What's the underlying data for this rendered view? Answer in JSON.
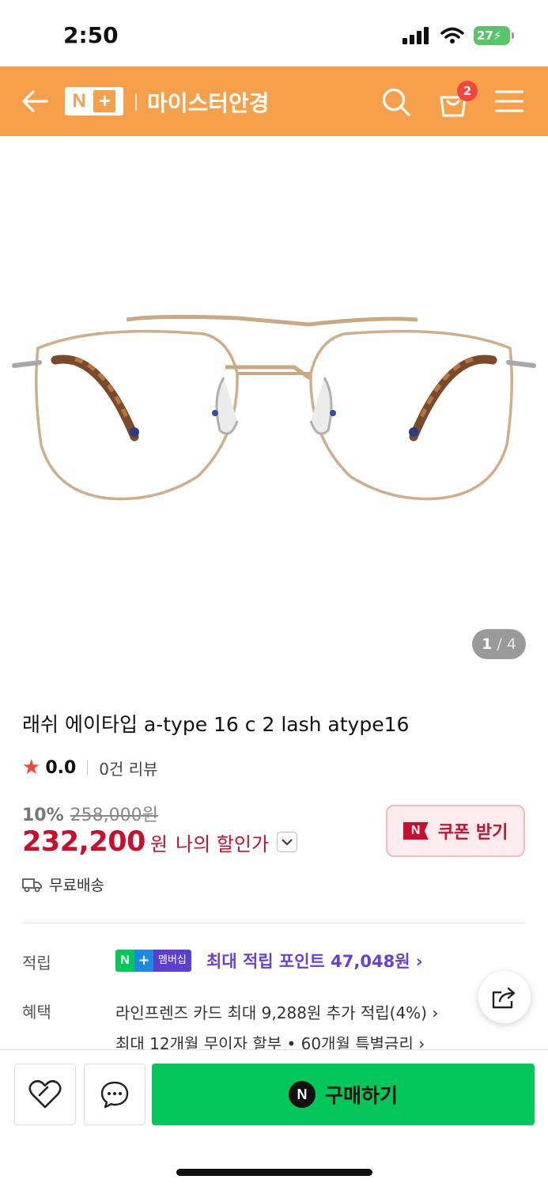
{
  "status": {
    "time": "2:50",
    "battery": "27"
  },
  "header": {
    "logo_n": "N",
    "logo_plus": "+",
    "store_name": "마이스터안경",
    "cart_count": "2"
  },
  "colors": {
    "header": "#f6a04c",
    "price": "#c8102e",
    "buy": "#03c75a",
    "points": "#6a3fd8"
  },
  "gallery": {
    "current": "1",
    "separator": "/",
    "total": "4"
  },
  "product": {
    "title": "래쉬 에이타입 a-type 16 c 2 lash atype16",
    "rating": "0.0",
    "review_count": "0건 리뷰",
    "discount_rate": "10%",
    "original_price": "258,000원",
    "price": "232,200",
    "currency": "원",
    "my_price_label": "나의 할인가",
    "coupon_label": "쿠폰 받기",
    "shipping": "무료배송"
  },
  "points": {
    "label": "적립",
    "membership_badge": "멤버십",
    "text": "최대 적립 포인트 47,048원"
  },
  "benefits": {
    "label": "혜택",
    "items": [
      "라인프렌즈 카드 최대 9,288원 추가 적립(4%)",
      "최대 12개월 무이자 할부 • 60개월 특별금리"
    ]
  },
  "bottom": {
    "buy_label": "구매하기"
  }
}
